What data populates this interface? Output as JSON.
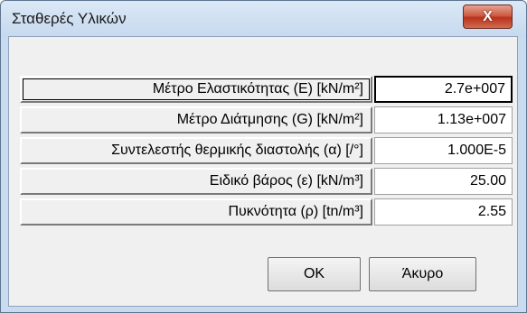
{
  "window": {
    "title": "Σταθερές Υλικών",
    "close_glyph": "X"
  },
  "fields": [
    {
      "label": "Μέτρο Ελαστικότητας (E) [kN/m²]",
      "value": "2.7e+007"
    },
    {
      "label": "Μέτρο Διάτμησης (G) [kN/m²]",
      "value": "1.13e+007"
    },
    {
      "label": "Συντελεστής θερμικής διαστολής (α) [/°]",
      "value": "1.000E-5"
    },
    {
      "label": "Ειδικό βάρος (ε) [kN/m³]",
      "value": "25.00"
    },
    {
      "label": "Πυκνότητα (ρ) [tn/m³]",
      "value": "2.55"
    }
  ],
  "buttons": {
    "ok": "OK",
    "cancel": "Άκυρο"
  }
}
